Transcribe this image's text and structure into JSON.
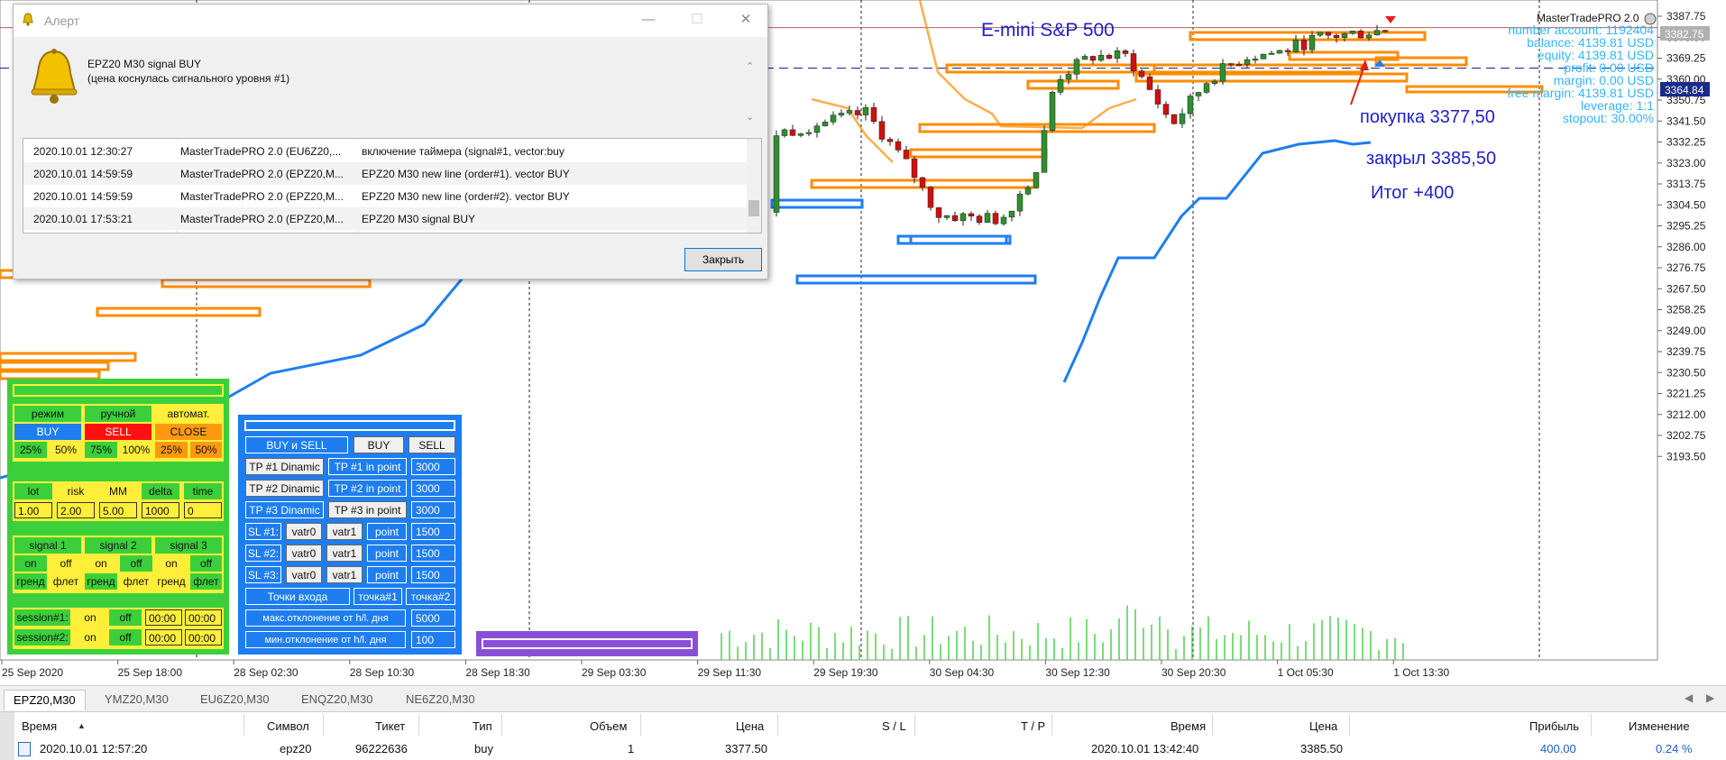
{
  "chart": {
    "title": "E-mini S&P 500",
    "indicator_name": "MasterTradePRO 2.0",
    "info_lines": [
      "number account: 1192404",
      "balance: 4139.81 USD",
      "equity: 4139.81 USD",
      "profit: 0.00 USD",
      "margin: 0.00 USD",
      "free margin: 4139.81 USD",
      "leverage: 1:1",
      "stopout: 30.00%"
    ],
    "price_labels": [
      "3387.75",
      "3378.50",
      "3369.25",
      "3360.00",
      "3350.75",
      "3341.50",
      "3332.25",
      "3323.00",
      "3313.75",
      "3304.50",
      "3295.25",
      "3286.00",
      "3276.75",
      "3267.50",
      "3258.25",
      "3249.00",
      "3239.75",
      "3230.50",
      "3221.25",
      "3212.00",
      "3202.75",
      "3193.50"
    ],
    "price_tag_bid": "3382.75",
    "price_tag_line": "3364.84",
    "time_labels": [
      "25 Sep 2020",
      "25 Sep 18:00",
      "28 Sep 02:30",
      "28 Sep 10:30",
      "28 Sep 18:30",
      "29 Sep 03:30",
      "29 Sep 11:30",
      "29 Sep 19:30",
      "30 Sep 04:30",
      "30 Sep 12:30",
      "30 Sep 20:30",
      "1 Oct 05:30",
      "1 Oct 13:30"
    ],
    "annotations": {
      "buy": "покупка 3377,50",
      "close": "закрыл 3385,50",
      "result": "Итог +400"
    },
    "colors": {
      "bull": "#2f8f2f",
      "bear": "#d01010",
      "orange": "#ff8c00",
      "blue": "#1e7ef0",
      "text_blue": "#2020c8",
      "info": "#33b5ff"
    }
  },
  "alert": {
    "title": "Алерт",
    "message_line1": "EPZ20 M30 signal BUY",
    "message_line2": "(цена коснулась сигнального уровня #1)",
    "rows": [
      [
        "2020.10.01 12:30:27",
        "MasterTradePRO 2.0 (EU6Z20,...",
        "включение таймера (signal#1, vector:buy"
      ],
      [
        "2020.10.01 14:59:59",
        "MasterTradePRO 2.0 (EPZ20,M...",
        "EPZ20 M30 new line (order#1). vector BUY"
      ],
      [
        "2020.10.01 14:59:59",
        "MasterTradePRO 2.0 (EPZ20,M...",
        "EPZ20 M30 new line (order#2). vector BUY"
      ],
      [
        "2020.10.01 17:53:21",
        "MasterTradePRO 2.0 (EPZ20,M...",
        "EPZ20 M30 signal BUY"
      ]
    ],
    "close_label": "Закрыть"
  },
  "green_panel": {
    "mode": [
      "режим",
      "ручной",
      "автомат."
    ],
    "actions": [
      "BUY",
      "SELL",
      "CLOSE"
    ],
    "percents": [
      "25%",
      "50%",
      "75%",
      "100%",
      "25%",
      "50%"
    ],
    "params": [
      "lot",
      "risk",
      "MM",
      "delta",
      "time"
    ],
    "param_values": [
      "1.00",
      "2.00",
      "5.00",
      "1000",
      "0"
    ],
    "signals": [
      "signal 1",
      "signal 2",
      "signal 3"
    ],
    "onoff": [
      "on",
      "off",
      "on",
      "off",
      "on",
      "off"
    ],
    "trend": [
      "гренд",
      "флет",
      "гренд",
      "флет",
      "гренд",
      "флет"
    ],
    "session1": [
      "session#1:",
      "on",
      "off",
      "00:00",
      "00:00"
    ],
    "session2": [
      "session#2:",
      "on",
      "off",
      "00:00",
      "00:00"
    ]
  },
  "blue_panel": {
    "modes": [
      "BUY и SELL",
      "BUY",
      "SELL"
    ],
    "tp_rows": [
      [
        "TP #1 Dinamic",
        "TP #1 in point",
        "3000"
      ],
      [
        "TP #2 Dinamic",
        "TP #2 in point",
        "3000"
      ],
      [
        "TP #3 Dinamic",
        "TP #3 in point",
        "3000"
      ]
    ],
    "sl_rows": [
      [
        "SL #1:",
        "vatr0",
        "vatr1",
        "point",
        "1500"
      ],
      [
        "SL #2:",
        "vatr0",
        "vatr1",
        "point",
        "1500"
      ],
      [
        "SL #3:",
        "vatr0",
        "vatr1",
        "point",
        "1500"
      ]
    ],
    "entry": [
      "Точки входа",
      "точка#1",
      "точка#2"
    ],
    "max_dev": [
      "макс.отклонение от h/l. дня",
      "5000"
    ],
    "min_dev": [
      "мин.отклонение от h/l. дня",
      "100"
    ]
  },
  "tabs": [
    "EPZ20,M30",
    "YMZ20,M30",
    "EU6Z20,M30",
    "ENQZ20,M30",
    "NE6Z20,M30"
  ],
  "table": {
    "headers": [
      "Время",
      "Символ",
      "Тикет",
      "Тип",
      "Объем",
      "Цена",
      "S / L",
      "T / P",
      "Время",
      "Цена",
      "Прибыль",
      "Изменение"
    ],
    "row": [
      "2020.10.01 12:57:20",
      "epz20",
      "96222636",
      "buy",
      "1",
      "3377.50",
      "",
      "",
      "2020.10.01 13:42:40",
      "3385.50",
      "400.00",
      "0.24 %"
    ]
  }
}
